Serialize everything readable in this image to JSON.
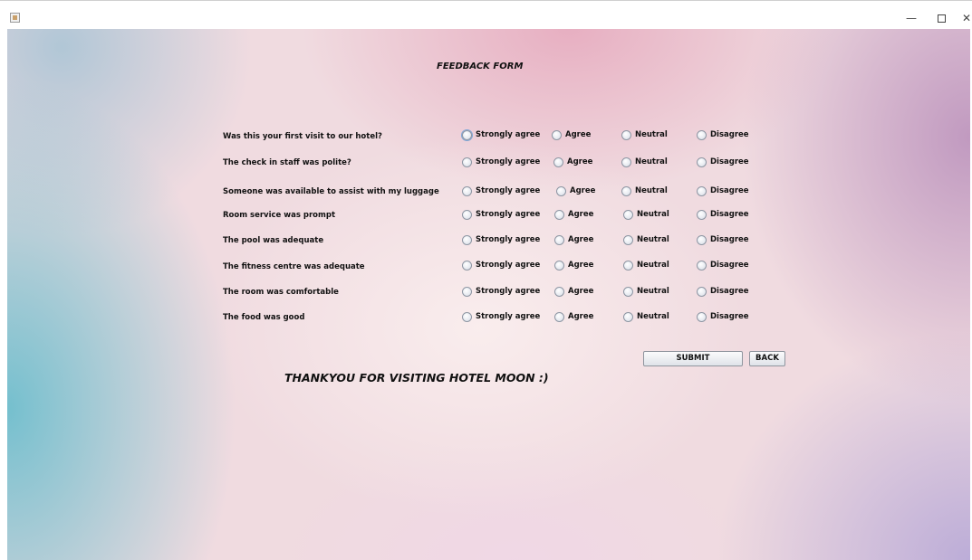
{
  "window": {
    "minimize_glyph": "—",
    "close_glyph": "✕"
  },
  "form": {
    "title": "FEEDBACK FORM",
    "options": [
      "Strongly agree",
      "Agree",
      "Neutral",
      "Disagree"
    ],
    "questions": [
      "Was this your first visit to our hotel?",
      "The check in staff was polite?",
      "Someone was available to assist with my luggage",
      "Room service was prompt",
      "The pool was adequate",
      "The fitness centre was adequate",
      "The room was comfortable",
      "The food was good"
    ],
    "submit_label": "SUBMIT",
    "back_label": "BACK",
    "thanks_message": "THANKYOU FOR VISITING HOTEL MOON  :)"
  }
}
